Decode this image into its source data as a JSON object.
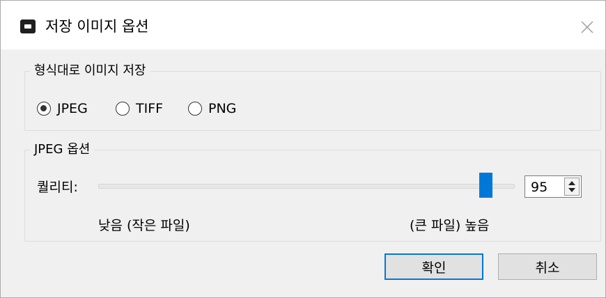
{
  "window": {
    "title": "저장 이미지 옵션",
    "icon": "app-icon",
    "close_icon": "close-icon"
  },
  "format_group": {
    "legend": "형식대로 이미지 저장",
    "options": [
      {
        "label": "JPEG",
        "checked": true
      },
      {
        "label": "TIFF",
        "checked": false
      },
      {
        "label": "PNG",
        "checked": false
      }
    ]
  },
  "jpeg_group": {
    "legend": "JPEG 옵션",
    "quality_label": "퀄리티:",
    "quality_value": "95",
    "quality_slider_fraction": 0.95,
    "low_label": "낮음 (작은 파일)",
    "high_label": "(큰 파일) 높음"
  },
  "buttons": {
    "ok": "확인",
    "cancel": "취소"
  },
  "colors": {
    "accent": "#0078d7",
    "background": "#f0f0f0"
  }
}
